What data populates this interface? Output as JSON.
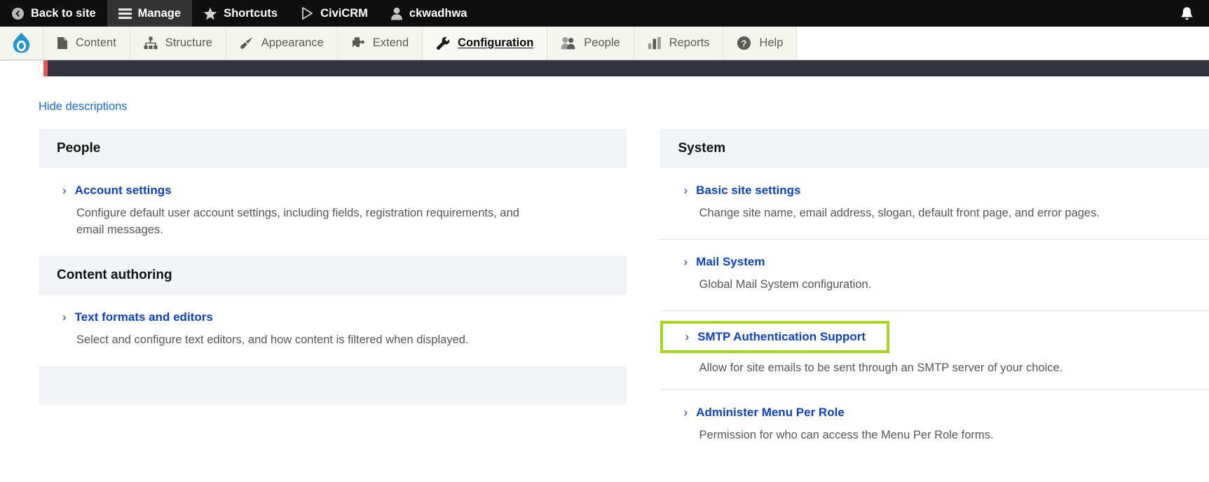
{
  "admin_bar": {
    "items": [
      {
        "label": "Back to site",
        "icon": "back-arrow-circle-icon",
        "active": false
      },
      {
        "label": "Manage",
        "icon": "hamburger-icon",
        "active": true
      },
      {
        "label": "Shortcuts",
        "icon": "star-icon",
        "active": false
      },
      {
        "label": "CiviCRM",
        "icon": "civicrm-triangle-icon",
        "active": false
      },
      {
        "label": "ckwadhwa",
        "icon": "user-icon",
        "active": false
      }
    ],
    "notification_icon": "bell-icon"
  },
  "menu_bar": {
    "logo_icon": "drupal-droplet-icon",
    "items": [
      {
        "label": "Content",
        "icon": "document-icon",
        "active": false
      },
      {
        "label": "Structure",
        "icon": "sitemap-icon",
        "active": false
      },
      {
        "label": "Appearance",
        "icon": "paintbrush-icon",
        "active": false
      },
      {
        "label": "Extend",
        "icon": "puzzle-piece-icon",
        "active": false
      },
      {
        "label": "Configuration",
        "icon": "wrench-icon",
        "active": true
      },
      {
        "label": "People",
        "icon": "people-icon",
        "active": false
      },
      {
        "label": "Reports",
        "icon": "bar-chart-icon",
        "active": false
      },
      {
        "label": "Help",
        "icon": "question-circle-icon",
        "active": false
      }
    ]
  },
  "page": {
    "hide_descriptions_label": "Hide descriptions",
    "left_column": [
      {
        "heading": "People",
        "entries": [
          {
            "title": "Account settings",
            "description": "Configure default user account settings, including fields, registration requirements, and email messages."
          }
        ]
      },
      {
        "heading": "Content authoring",
        "entries": [
          {
            "title": "Text formats and editors",
            "description": "Select and configure text editors, and how content is filtered when displayed."
          }
        ]
      }
    ],
    "right_column": [
      {
        "heading": "System",
        "entries": [
          {
            "title": "Basic site settings",
            "description": "Change site name, email address, slogan, default front page, and error pages."
          },
          {
            "title": "Mail System",
            "description": "Global Mail System configuration."
          },
          {
            "title": "SMTP Authentication Support",
            "description": "Allow for site emails to be sent through an SMTP server of your choice.",
            "highlighted": true
          },
          {
            "title": "Administer Menu Per Role",
            "description": "Permission for who can access the Menu Per Role forms."
          }
        ]
      }
    ]
  },
  "colors": {
    "admin_bar_bg": "#0f0f0f",
    "admin_bar_active": "#333333",
    "menu_bar_bg": "#f5f5f0",
    "navy_bar": "#33343f",
    "navy_accent_red": "#ef5350",
    "section_head_bg": "#f1f3f7",
    "link_blue": "#0b41c9",
    "hide_desc_blue": "#126ecf",
    "highlight_green": "#a8d61c",
    "drupal_blue": "#2196d4"
  },
  "chevron_glyph": "›"
}
